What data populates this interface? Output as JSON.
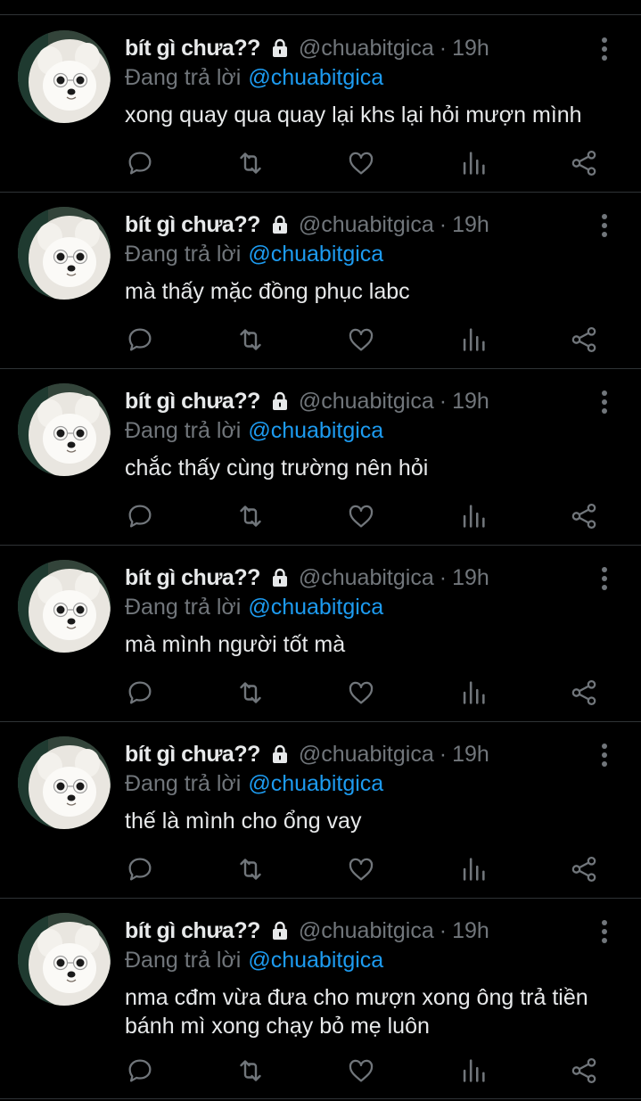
{
  "colors": {
    "background": "#000000",
    "primary_text": "#e7e9ea",
    "secondary_text": "#71767b",
    "link": "#1d9bf0",
    "divider": "#2f3336"
  },
  "tweets": [
    {
      "display_name": "bít gì chưa??",
      "handle": "@chuabitgica",
      "separator": "·",
      "time": "19h",
      "reply_prefix": "Đang trả lời",
      "reply_to": "@chuabitgica",
      "text": "xong quay qua quay lại khs lại hỏi mượn mình"
    },
    {
      "display_name": "bít gì chưa??",
      "handle": "@chuabitgica",
      "separator": "·",
      "time": "19h",
      "reply_prefix": "Đang trả lời",
      "reply_to": "@chuabitgica",
      "text": "mà thấy mặc đồng phục labc"
    },
    {
      "display_name": "bít gì chưa??",
      "handle": "@chuabitgica",
      "separator": "·",
      "time": "19h",
      "reply_prefix": "Đang trả lời",
      "reply_to": "@chuabitgica",
      "text": "chắc thấy cùng trường nên hỏi"
    },
    {
      "display_name": "bít gì chưa??",
      "handle": "@chuabitgica",
      "separator": "·",
      "time": "19h",
      "reply_prefix": "Đang trả lời",
      "reply_to": "@chuabitgica",
      "text": "mà mình người tốt mà"
    },
    {
      "display_name": "bít gì chưa??",
      "handle": "@chuabitgica",
      "separator": "·",
      "time": "19h",
      "reply_prefix": "Đang trả lời",
      "reply_to": "@chuabitgica",
      "text": "thế là mình cho ổng vay"
    },
    {
      "display_name": "bít gì chưa??",
      "handle": "@chuabitgica",
      "separator": "·",
      "time": "19h",
      "reply_prefix": "Đang trả lời",
      "reply_to": "@chuabitgica",
      "text": "nma cđm vừa đưa cho mượn xong ông trả tiền bánh mì xong chạy bỏ mẹ luôn"
    }
  ],
  "icons": {
    "avatar": "white-pomeranian-dog-avatar",
    "lock": "lock-icon",
    "more": "vertical-dots-icon",
    "reply": "speech-bubble-icon",
    "retweet": "retweet-arrows-icon",
    "like": "heart-icon",
    "views": "bar-chart-icon",
    "share": "share-icon"
  }
}
